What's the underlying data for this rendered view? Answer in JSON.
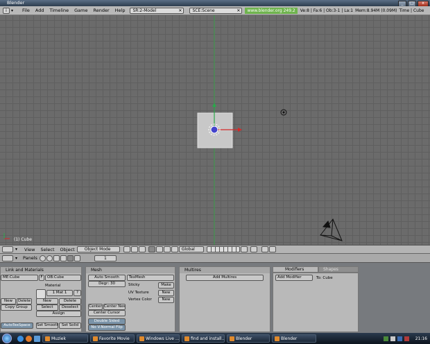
{
  "window": {
    "title": "Blender"
  },
  "menubar": {
    "items": [
      "File",
      "Add",
      "Timeline",
      "Game",
      "Render",
      "Help"
    ],
    "screen_field": "SR:2-Model",
    "scene_field": "SCE:Scene",
    "url": "www.blender.org 249.2",
    "stats": "Ve:8 | Fa:6 | Ob:3-1 | La:1",
    "memory": "Mem:8.94M (0.09M)",
    "mode_info": "Time | Cube"
  },
  "viewport": {
    "object_label": "(1) Cube"
  },
  "view_header": {
    "menus": [
      "View",
      "Select",
      "Object"
    ],
    "mode": "Object Mode",
    "orientation": "Global"
  },
  "buttons_header": {
    "panels_label": "Panels",
    "frame": "1"
  },
  "link_materials": {
    "title": "Link and Materials",
    "me_field": "ME:Cube",
    "f_label": "F",
    "ob_field": "OB:Cube",
    "material_label": "Material",
    "mat_index": "1 Mat 1",
    "help": "?",
    "new1": "New",
    "delete1": "Delete",
    "copy_group": "Copy Group",
    "new2": "New",
    "delete2": "Delete",
    "select": "Select",
    "deselect": "Deselect",
    "assign": "Assign",
    "autotexspace": "AutoTexSpace",
    "set_smooth": "Set Smooth",
    "set_solid": "Set Solid"
  },
  "mesh": {
    "title": "Mesh",
    "auto_smooth": "Auto Smooth",
    "degr": "Degr: 30",
    "texmesh": "TexMesh",
    "sticky": "Sticky",
    "make": "Make",
    "uv_texture": "UV Texture",
    "vertex_color": "Vertex Color",
    "new_uv": "New",
    "new_vc": "New",
    "center": "Center",
    "center_new": "Center New",
    "center_cursor": "Center Cursor",
    "double_sided": "Double Sided",
    "no_v_normal_flip": "No V.Normal Flip"
  },
  "multires": {
    "title": "Multires",
    "add_multires": "Add Multires"
  },
  "modifiers": {
    "tab_modifiers": "Modifiers",
    "tab_shapes": "Shapes",
    "add_modifier": "Add Modifier",
    "to_label": "To: Cube"
  },
  "taskbar": {
    "tasks": [
      "Muziek",
      "Favorite Movie",
      "Windows Live ...",
      "find and install...",
      "Blender",
      "Blender"
    ],
    "clock": "21:16"
  },
  "colors": {
    "viewport_bg": "#6b6b6b",
    "selected_cube": "#c8c8c8",
    "x_axis": "#d42a2a",
    "y_axis": "#2aa84a",
    "url_bg": "#6fb44e"
  }
}
